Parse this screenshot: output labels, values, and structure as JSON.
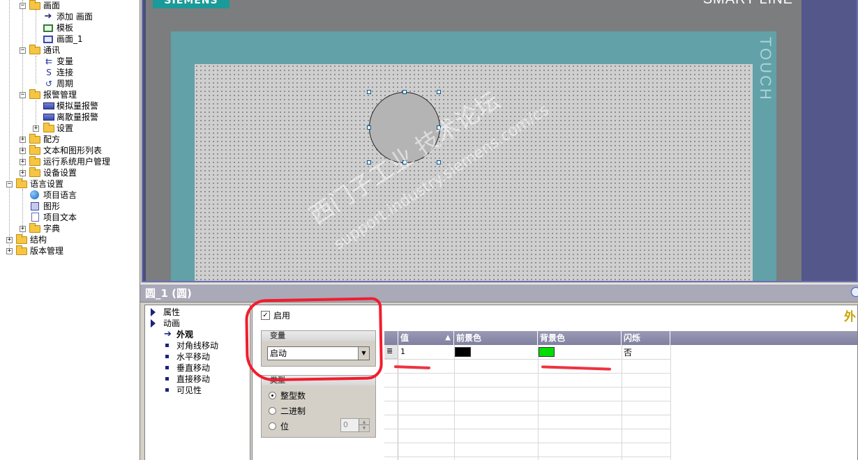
{
  "tree": {
    "items": [
      {
        "label": "画面"
      },
      {
        "label": "添加 画面"
      },
      {
        "label": "模板"
      },
      {
        "label": "画面_1"
      },
      {
        "label": "通讯"
      },
      {
        "label": "变量"
      },
      {
        "label": "连接"
      },
      {
        "label": "周期"
      },
      {
        "label": "报警管理"
      },
      {
        "label": "模拟量报警"
      },
      {
        "label": "离散量报警"
      },
      {
        "label": "设置"
      },
      {
        "label": "配方"
      },
      {
        "label": "文本和图形列表"
      },
      {
        "label": "运行系统用户管理"
      },
      {
        "label": "设备设置"
      },
      {
        "label": "语言设置"
      },
      {
        "label": "项目语言"
      },
      {
        "label": "图形"
      },
      {
        "label": "项目文本"
      },
      {
        "label": "字典"
      },
      {
        "label": "结构"
      },
      {
        "label": "版本管理"
      }
    ]
  },
  "device": {
    "brand": "SIEMENS",
    "line": "SMART LINE",
    "touch": "TOUCH"
  },
  "watermark": {
    "line1": "西门子工业 技术论坛",
    "line2": "support.industry.siemens.com/cs"
  },
  "properties": {
    "title": "圆_1 (圆)",
    "corner_label": "外",
    "nav": [
      {
        "label": "属性"
      },
      {
        "label": "动画"
      },
      {
        "label": "外观"
      },
      {
        "label": "对角线移动"
      },
      {
        "label": "水平移动"
      },
      {
        "label": "垂直移动"
      },
      {
        "label": "直接移动"
      },
      {
        "label": "可见性"
      }
    ],
    "enable_label": "启用",
    "enable_check": "✓",
    "variable_group": {
      "header": "变量",
      "value": "启动"
    },
    "type_group": {
      "header": "类型",
      "options": [
        "整型数",
        "二进制",
        "位"
      ],
      "selected": "整型数",
      "bit_value": "0"
    },
    "grid": {
      "columns": [
        "值",
        "前景色",
        "背景色",
        "闪烁"
      ],
      "rows": [
        {
          "value": "1",
          "foreground": "#000000",
          "background": "#00dd00",
          "blink": "否"
        }
      ]
    }
  },
  "colors": {
    "accent_teal": "#1a9a98",
    "bezel": "#62a1a8",
    "annotation_red": "#f21c2e"
  }
}
